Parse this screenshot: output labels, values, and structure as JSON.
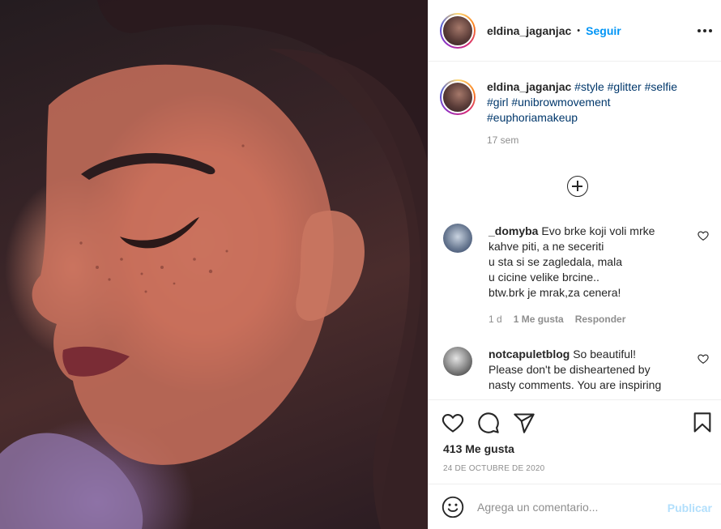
{
  "post": {
    "author": "eldina_jaganjac",
    "separator": "•",
    "follow_label": "Seguir",
    "caption": {
      "username": "eldina_jaganjac",
      "hashtags": [
        "#style",
        "#glitter",
        "#selfie",
        "#girl",
        "#unibrowmovement",
        "#euphoriamakeup"
      ],
      "time_ago": "17 sem"
    },
    "likes": "413 Me gusta",
    "date": "24 DE OCTUBRE DE 2020"
  },
  "comments": [
    {
      "username": "_domyba",
      "lines": [
        "Evo brke koji voli mrke",
        "kahve piti, a ne seceriti",
        "u sta si se zagledala, mala",
        "u cicine velike brcine..",
        "btw.brk je mrak,za cenera!"
      ],
      "time": "1 d",
      "likes": "1 Me gusta",
      "reply": "Responder"
    },
    {
      "username": "notcapuletblog",
      "lines": [
        "So beautiful!",
        "Please don't be disheartened by",
        "nasty comments. You are inspiring"
      ]
    }
  ],
  "composer": {
    "placeholder": "Agrega un comentario...",
    "publish": "Publicar"
  },
  "icons": {
    "more": "more-options-icon",
    "load_more": "plus-circle-icon",
    "comment_like": "heart-outline-icon",
    "like": "heart-icon",
    "comment": "comment-icon",
    "share": "paper-plane-icon",
    "save": "bookmark-icon",
    "emoji": "smiley-icon"
  },
  "colors": {
    "accent": "#0095f6",
    "hashtag": "#00376b",
    "muted": "#8e8e8e",
    "publish_disabled": "#b2dffc"
  }
}
